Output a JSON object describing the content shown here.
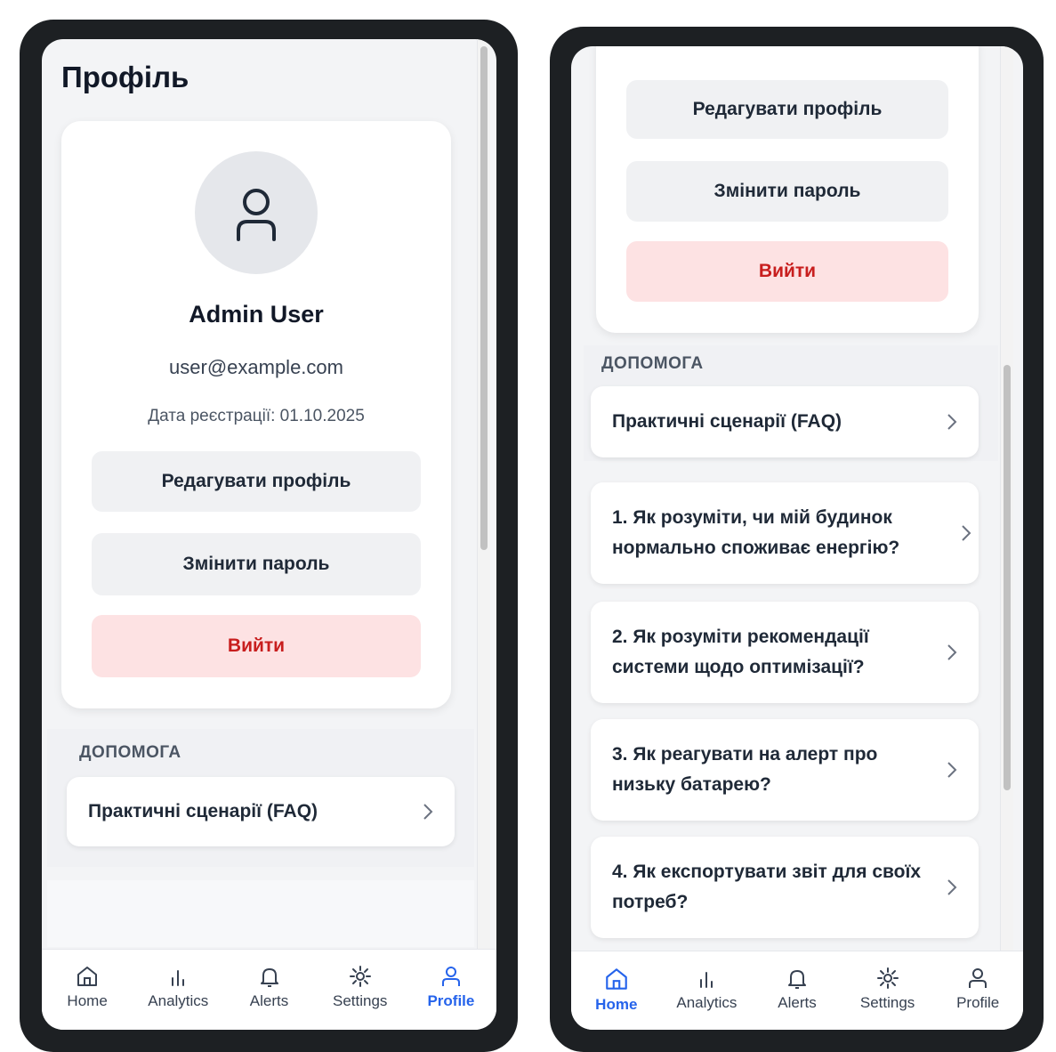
{
  "colors": {
    "accent": "#2563eb",
    "danger_text": "#c81e1e",
    "danger_bg": "#fde2e3",
    "frame": "#1d2023"
  },
  "left_screen": {
    "title": "Профіль",
    "profile": {
      "avatar_icon": "user-icon",
      "name": "Admin User",
      "email": "user@example.com",
      "registered": "Дата реєстрації: 01.10.2025",
      "edit_button": "Редагувати профіль",
      "change_password_button": "Змінити пароль",
      "logout_button": "Вийти"
    },
    "help": {
      "section_label": "ДОПОМОГА",
      "faq_link": "Практичні сценарії (FAQ)"
    },
    "nav": {
      "active": "Profile",
      "items": [
        {
          "label": "Home",
          "icon": "home-icon"
        },
        {
          "label": "Analytics",
          "icon": "analytics-icon"
        },
        {
          "label": "Alerts",
          "icon": "bell-icon"
        },
        {
          "label": "Settings",
          "icon": "gear-icon"
        },
        {
          "label": "Profile",
          "icon": "user-icon"
        }
      ]
    }
  },
  "right_screen": {
    "profile": {
      "edit_button": "Редагувати профіль",
      "change_password_button": "Змінити пароль",
      "logout_button": "Вийти"
    },
    "help": {
      "section_label": "ДОПОМОГА",
      "faq_link": "Практичні сценарії (FAQ)",
      "faq_items": [
        "1. Як розуміти, чи мій будинок нормально споживає енергію?",
        "2. Як розуміти рекомендації системи щодо оптимізації?",
        "3. Як реагувати на алерт про низьку батарею?",
        "4. Як експортувати звіт для своїх потреб?"
      ]
    },
    "nav": {
      "active": "Home",
      "items": [
        {
          "label": "Home",
          "icon": "home-icon"
        },
        {
          "label": "Analytics",
          "icon": "analytics-icon"
        },
        {
          "label": "Alerts",
          "icon": "bell-icon"
        },
        {
          "label": "Settings",
          "icon": "gear-icon"
        },
        {
          "label": "Profile",
          "icon": "user-icon"
        }
      ]
    }
  }
}
